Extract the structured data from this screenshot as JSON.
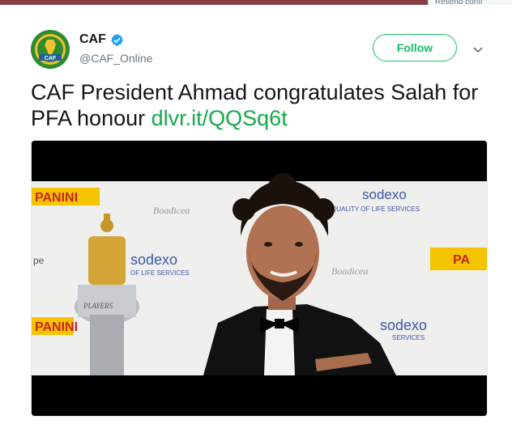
{
  "top_bar": {
    "tab_label": "Resend confi"
  },
  "tweet": {
    "author_name": "CAF",
    "author_handle": "@CAF_Online",
    "avatar_text": "CAF",
    "follow_label": "Follow",
    "text": "CAF President Ahmad congratulates Salah for PFA honour",
    "link_text": "dlvr.it/QQSq6t"
  },
  "media": {
    "backdrop_words": [
      "PANINI",
      "sodexo",
      "QUALITY OF LIFE SERVICES",
      "Boadicea",
      "sodexo",
      "OF LIFE SERVICES",
      "PANINI",
      "sodexo",
      "SERVICES",
      "Boadicea",
      "PA",
      "pe",
      "PLAYERS"
    ]
  },
  "colors": {
    "accent_green": "#17bf63",
    "link_green": "#17a84a",
    "verified_blue": "#1da1f2"
  },
  "icons": [
    "verified-badge-icon",
    "chevron-down-icon",
    "caf-logo"
  ]
}
